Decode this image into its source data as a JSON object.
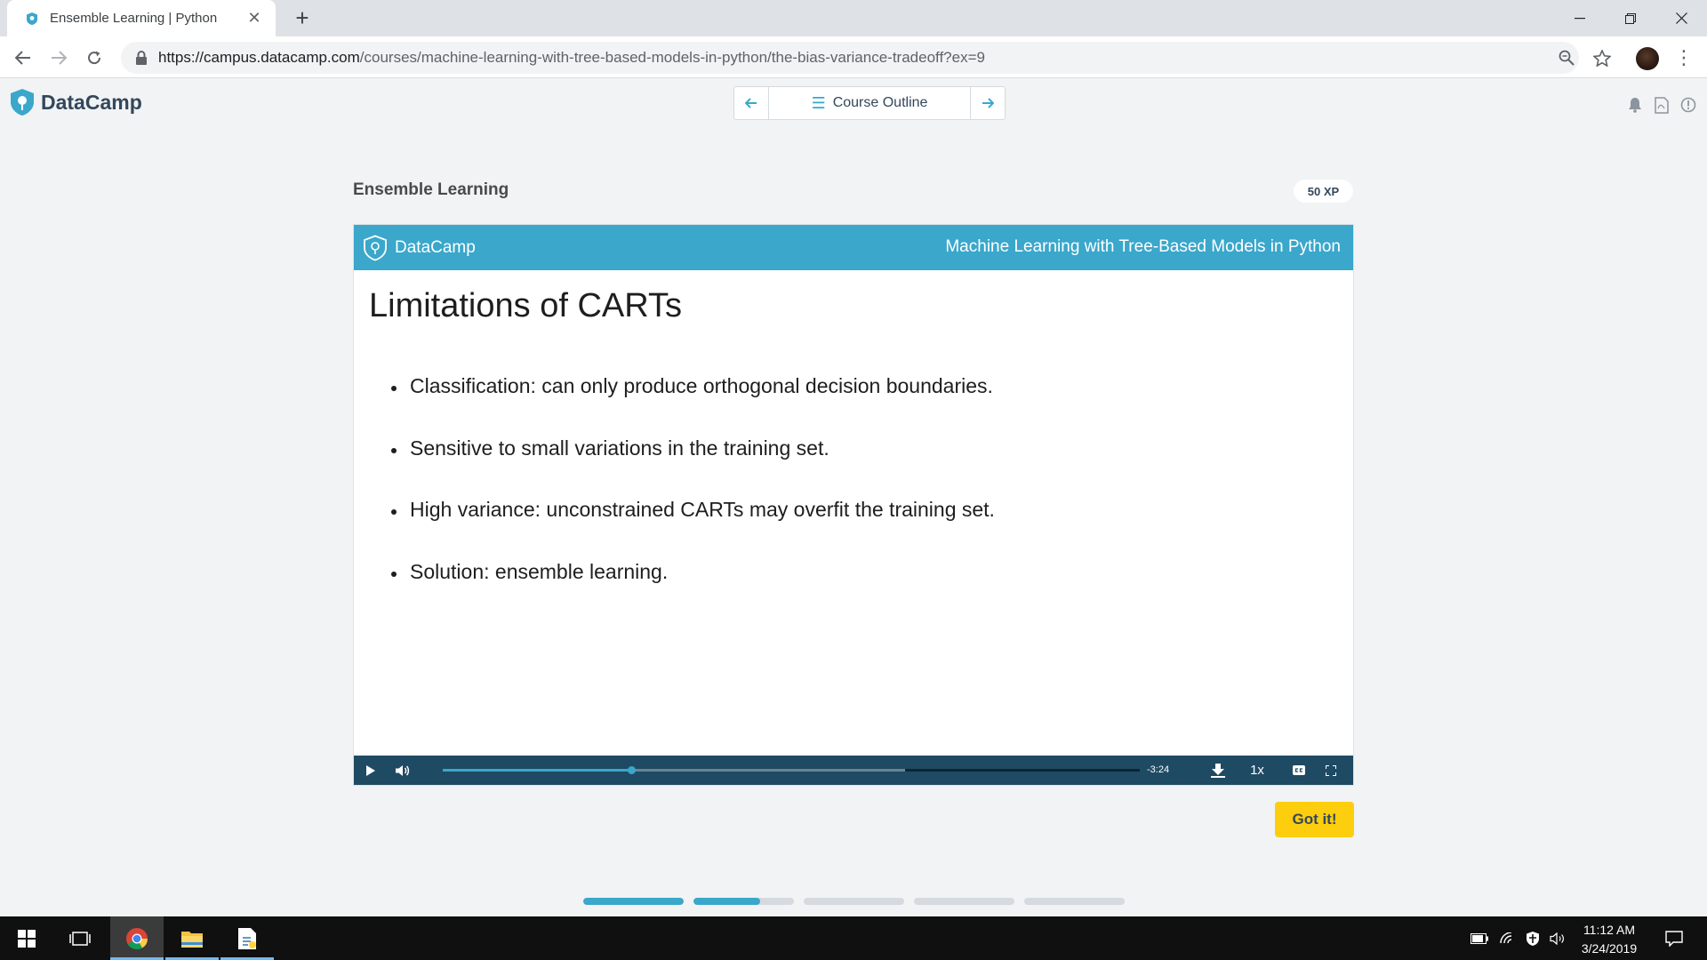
{
  "browser": {
    "tab_title": "Ensemble Learning | Python",
    "new_tab": "+",
    "url_host": "https://campus.datacamp.com",
    "url_path": "/courses/machine-learning-with-tree-based-models-in-python/the-bias-variance-tradeoff?ex=9"
  },
  "header": {
    "brand": "DataCamp",
    "outline_label": "Course Outline"
  },
  "exercise": {
    "title": "Ensemble Learning",
    "xp": "50 XP"
  },
  "slide": {
    "brand": "DataCamp",
    "course": "Machine Learning with Tree-Based Models in Python",
    "title": "Limitations of CARTs",
    "bullets": [
      "Classification: can only produce orthogonal decision boundaries.",
      "Sensitive to small variations in the training set.",
      "High variance: unconstrained CARTs may overfit the training set.",
      "Solution: ensemble learning."
    ]
  },
  "video": {
    "time_remaining": "-3:24",
    "speed": "1x",
    "played_fraction": 0.271,
    "buffered_fraction": 0.663
  },
  "actions": {
    "got_it": "Got it!"
  },
  "lesson_progress": [
    1.0,
    0.66,
    0.0,
    0.0,
    0.0
  ],
  "taskbar": {
    "time": "11:12 AM",
    "date": "3/24/2019"
  },
  "colors": {
    "accent": "#3aa7cb",
    "slide_header": "#3aa7cb",
    "controls_bg": "#1f4a63",
    "got_it": "#fcce0d",
    "brand_text": "#33475b"
  }
}
